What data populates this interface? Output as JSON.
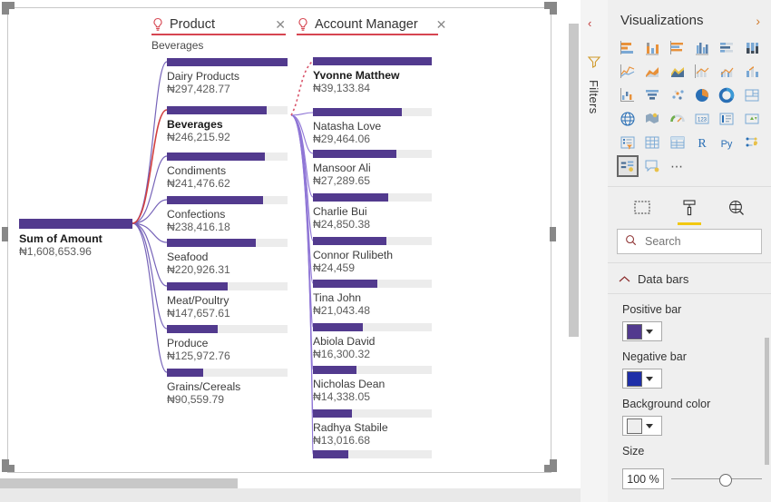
{
  "canvas": {
    "root_node": {
      "label": "Sum of Amount",
      "value": "₦1,608,653.96",
      "fill_pct": 100
    },
    "levels": [
      {
        "field_title": "Product",
        "subtitle": "Beverages",
        "close_label": "✕",
        "bulb_icon": "lightbulb-icon",
        "nodes": [
          {
            "label": "Dairy Products",
            "value": "₦297,428.77",
            "fill_pct": 100,
            "selected": false
          },
          {
            "label": "Beverages",
            "value": "₦246,215.92",
            "fill_pct": 83,
            "selected": true
          },
          {
            "label": "Condiments",
            "value": "₦241,476.62",
            "fill_pct": 81,
            "selected": false
          },
          {
            "label": "Confections",
            "value": "₦238,416.18",
            "fill_pct": 80,
            "selected": false
          },
          {
            "label": "Seafood",
            "value": "₦220,926.31",
            "fill_pct": 74,
            "selected": false
          },
          {
            "label": "Meat/Poultry",
            "value": "₦147,657.61",
            "fill_pct": 50,
            "selected": false
          },
          {
            "label": "Produce",
            "value": "₦125,972.76",
            "fill_pct": 42,
            "selected": false
          },
          {
            "label": "Grains/Cereals",
            "value": "₦90,559.79",
            "fill_pct": 30,
            "selected": false
          }
        ]
      },
      {
        "field_title": "Account Manager",
        "subtitle": "",
        "close_label": "✕",
        "bulb_icon": "lightbulb-icon",
        "nodes": [
          {
            "label": "Yvonne Matthew",
            "value": "₦39,133.84",
            "fill_pct": 100,
            "selected": true
          },
          {
            "label": "Natasha Love",
            "value": "₦29,464.06",
            "fill_pct": 75,
            "selected": false
          },
          {
            "label": "Mansoor Ali",
            "value": "₦27,289.65",
            "fill_pct": 70,
            "selected": false
          },
          {
            "label": "Charlie Bui",
            "value": "₦24,850.38",
            "fill_pct": 63,
            "selected": false
          },
          {
            "label": "Connor Rulibeth",
            "value": "₦24,459",
            "fill_pct": 62,
            "selected": false
          },
          {
            "label": "Tina John",
            "value": "₦21,043.48",
            "fill_pct": 54,
            "selected": false
          },
          {
            "label": "Abiola David",
            "value": "₦16,300.32",
            "fill_pct": 42,
            "selected": false
          },
          {
            "label": "Nicholas Dean",
            "value": "₦14,338.05",
            "fill_pct": 37,
            "selected": false
          },
          {
            "label": "Radhya Stabile",
            "value": "₦13,016.68",
            "fill_pct": 33,
            "selected": false
          },
          {
            "label": "",
            "value": "",
            "fill_pct": 30,
            "selected": false
          }
        ]
      }
    ],
    "colors": {
      "bar_fill": "#523a8e",
      "bar_track": "#ececec",
      "link": "#6f5bb5",
      "link_highlight": "#d13f3f",
      "header_underline": "#d64550"
    }
  },
  "filters_rail": {
    "collapse_label": "‹",
    "funnel_icon": "funnel-icon",
    "title": "Filters"
  },
  "viz_pane": {
    "title": "Visualizations",
    "expand_label": "›",
    "icons": [
      "stacked-bar-chart-icon",
      "stacked-column-chart-icon",
      "clustered-bar-chart-icon",
      "clustered-column-chart-icon",
      "100-stacked-bar-chart-icon",
      "100-stacked-column-chart-icon",
      "line-chart-icon",
      "area-chart-icon",
      "stacked-area-chart-icon",
      "line-stacked-column-icon",
      "line-clustered-column-icon",
      "ribbon-chart-icon",
      "waterfall-chart-icon",
      "funnel-chart-icon",
      "scatter-chart-icon",
      "pie-chart-icon",
      "donut-chart-icon",
      "treemap-icon",
      "map-icon",
      "filled-map-icon",
      "gauge-icon",
      "card-icon",
      "multi-row-card-icon",
      "kpi-icon",
      "slicer-icon",
      "table-icon",
      "matrix-icon",
      "r-script-visual-icon",
      "python-visual-icon",
      "key-influencers-icon",
      "decomposition-tree-icon",
      "qna-visual-icon",
      "more-visuals-icon"
    ],
    "selected_icon": "decomposition-tree-icon",
    "format_tabs": [
      "fields-tab",
      "format-tab",
      "analytics-tab"
    ],
    "active_format_tab": "format-tab",
    "search": {
      "placeholder": "Search",
      "value": "",
      "icon": "search-icon"
    },
    "sections": [
      {
        "name": "Data bars",
        "expanded": true,
        "collapse_icon": "chevron-up-icon",
        "properties": [
          {
            "label": "Positive bar",
            "type": "color",
            "color": "#523a8e"
          },
          {
            "label": "Negative bar",
            "type": "color",
            "color": "#1f2fa8"
          },
          {
            "label": "Background color",
            "type": "color",
            "color": "#eeeeee"
          },
          {
            "label": "Size",
            "type": "slider",
            "value": "100 %",
            "slider_pct": 53
          }
        ]
      }
    ]
  }
}
